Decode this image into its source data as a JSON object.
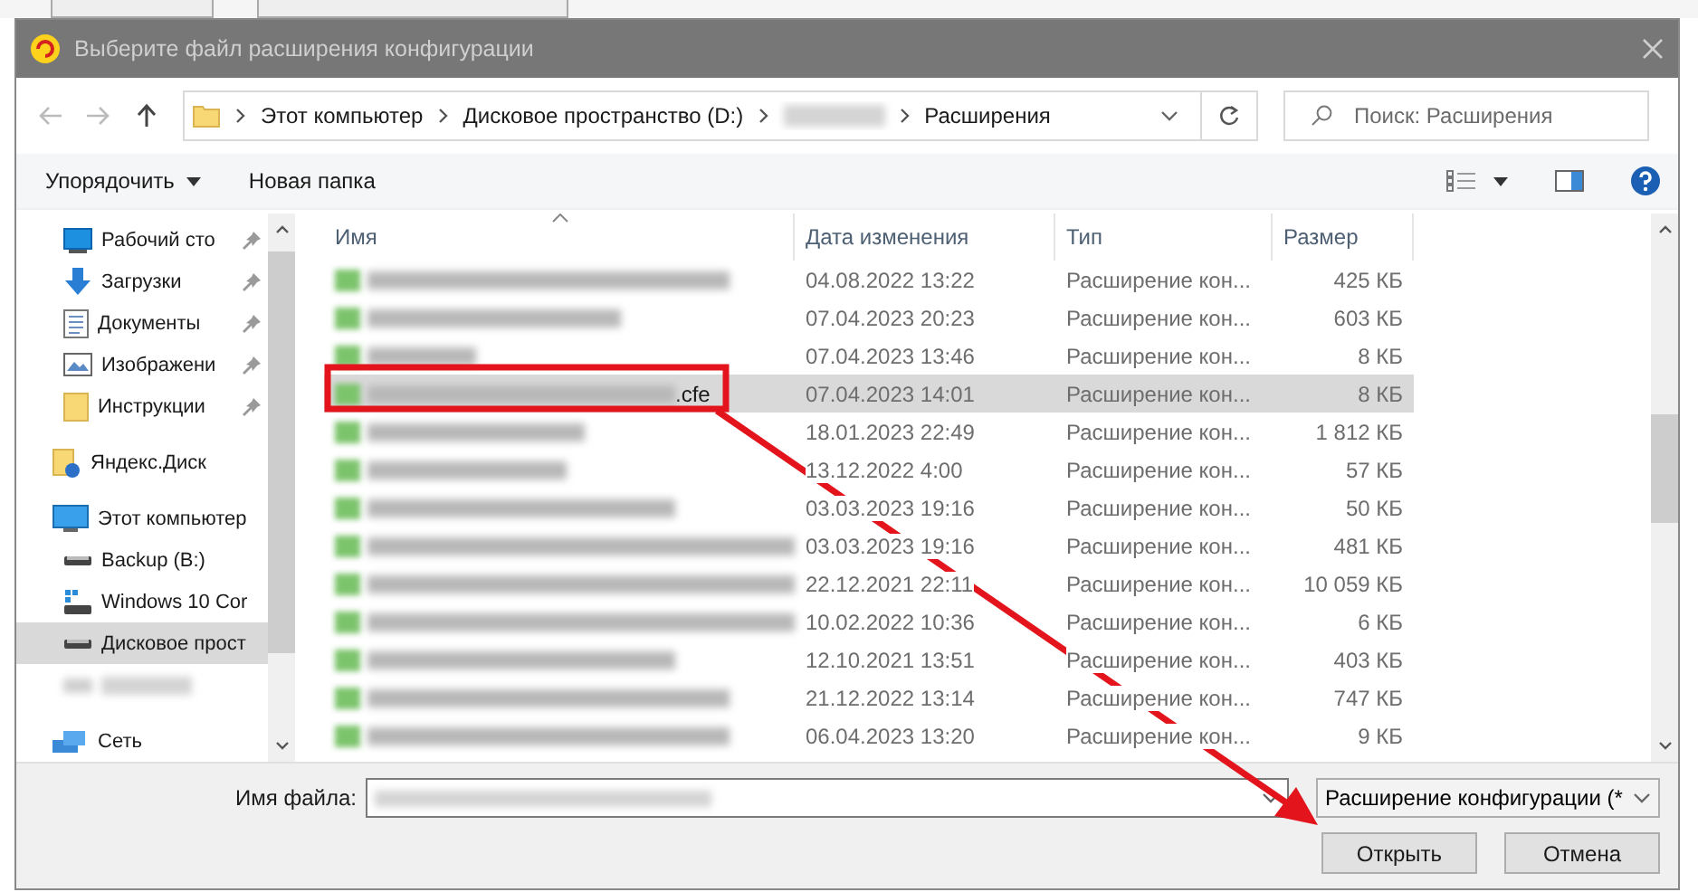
{
  "window": {
    "title": "Выберите файл расширения конфигурации"
  },
  "address": {
    "crumbs": [
      {
        "kind": "text",
        "label": "Этот компьютер"
      },
      {
        "kind": "text",
        "label": "Дисковое пространство (D:)"
      },
      {
        "kind": "redacted"
      },
      {
        "kind": "text",
        "label": "Расширения"
      }
    ]
  },
  "search": {
    "placeholder": "Поиск: Расширения"
  },
  "toolbar": {
    "organize": "Упорядочить",
    "new_folder": "Новая папка"
  },
  "nav": {
    "quick_access": [
      {
        "kind": "desktop",
        "label": "Рабочий сто",
        "pinned": true,
        "selected": false
      },
      {
        "kind": "downloads",
        "label": "Загрузки",
        "pinned": true,
        "selected": false
      },
      {
        "kind": "documents",
        "label": "Документы",
        "pinned": true,
        "selected": false
      },
      {
        "kind": "pictures",
        "label": "Изображени",
        "pinned": true,
        "selected": false
      },
      {
        "kind": "folder",
        "label": "Инструкции",
        "pinned": true,
        "selected": false
      }
    ],
    "items": [
      {
        "kind": "cloud",
        "label": "Яндекс.Диск",
        "selected": false
      },
      {
        "kind": "computer",
        "label": "Этот компьютер",
        "selected": false,
        "children": [
          {
            "kind": "drive",
            "label": "Backup (B:)",
            "selected": false
          },
          {
            "kind": "windows-drive",
            "label": "Windows 10 Cor",
            "selected": false
          },
          {
            "kind": "drive",
            "label": "Дисковое прост",
            "selected": true
          },
          {
            "kind": "redacted",
            "selected": false
          }
        ]
      },
      {
        "kind": "network",
        "label": "Сеть",
        "selected": false
      }
    ]
  },
  "table": {
    "columns": [
      "Имя",
      "Дата изменения",
      "Тип",
      "Размер"
    ],
    "rows": [
      {
        "date": "04.08.2022 13:22",
        "type": "Расширение кон...",
        "size": "425 КБ",
        "selected": false
      },
      {
        "date": "07.04.2023 20:23",
        "type": "Расширение кон...",
        "size": "603 КБ",
        "selected": false
      },
      {
        "date": "07.04.2023 13:46",
        "type": "Расширение кон...",
        "size": "8 КБ",
        "selected": false
      },
      {
        "name_visible": ".cfe",
        "date": "07.04.2023 14:01",
        "type": "Расширение кон...",
        "size": "8 КБ",
        "selected": true
      },
      {
        "date": "18.01.2023 22:49",
        "type": "Расширение кон...",
        "size": "1 812 КБ",
        "selected": false
      },
      {
        "date": "13.12.2022 4:00",
        "type": "Расширение кон...",
        "size": "57 КБ",
        "selected": false
      },
      {
        "date": "03.03.2023 19:16",
        "type": "Расширение кон...",
        "size": "50 КБ",
        "selected": false
      },
      {
        "date": "03.03.2023 19:16",
        "type": "Расширение кон...",
        "size": "481 КБ",
        "selected": false
      },
      {
        "date": "22.12.2021 22:11",
        "type": "Расширение кон...",
        "size": "10 059 КБ",
        "selected": false
      },
      {
        "date": "10.02.2022 10:36",
        "type": "Расширение кон...",
        "size": "6 КБ",
        "selected": false
      },
      {
        "date": "12.10.2021 13:51",
        "type": "Расширение кон...",
        "size": "403 КБ",
        "selected": false
      },
      {
        "date": "21.12.2022 13:14",
        "type": "Расширение кон...",
        "size": "747 КБ",
        "selected": false
      },
      {
        "date": "06.04.2023 13:20",
        "type": "Расширение кон...",
        "size": "9 КБ",
        "selected": false
      }
    ]
  },
  "footer": {
    "filename_label": "Имя файла:",
    "filter": "Расширение конфигурации (*",
    "open": "Открыть",
    "cancel": "Отмена"
  },
  "callout": {
    "frame": true,
    "arrow": true
  }
}
